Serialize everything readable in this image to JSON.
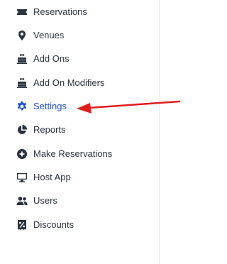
{
  "sidebar": {
    "items": [
      {
        "label": "Reservations",
        "icon": "ticket-icon"
      },
      {
        "label": "Venues",
        "icon": "map-pin-icon"
      },
      {
        "label": "Add Ons",
        "icon": "cake-icon"
      },
      {
        "label": "Add On Modifiers",
        "icon": "cake-icon"
      },
      {
        "label": "Settings",
        "icon": "gear-icon",
        "active": true
      },
      {
        "label": "Reports",
        "icon": "pie-chart-icon"
      },
      {
        "label": "Make Reservations",
        "icon": "plus-circle-icon"
      },
      {
        "label": "Host App",
        "icon": "monitor-icon"
      },
      {
        "label": "Users",
        "icon": "users-icon"
      },
      {
        "label": "Discounts",
        "icon": "discount-icon"
      }
    ]
  },
  "annotation": {
    "color": "#e11d1d"
  },
  "colors": {
    "text": "#2b3340",
    "active": "#1d4ed8"
  }
}
